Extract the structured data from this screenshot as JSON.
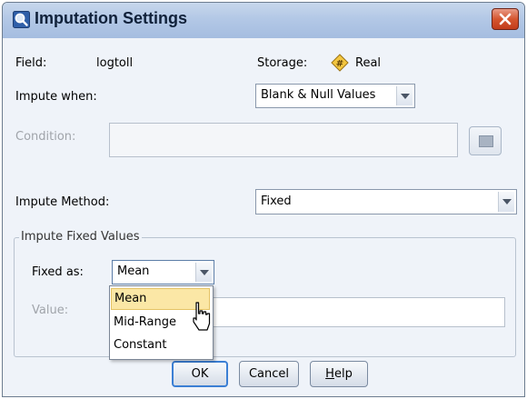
{
  "window": {
    "title": "Imputation Settings",
    "close_label": "Close"
  },
  "field": {
    "label": "Field:",
    "value": "logtoll"
  },
  "storage": {
    "label": "Storage:",
    "value": "Real",
    "icon": "real-storage-icon"
  },
  "impute_when": {
    "label": "Impute when:",
    "value": "Blank & Null Values"
  },
  "condition": {
    "label": "Condition:",
    "value": ""
  },
  "impute_method": {
    "label": "Impute Method:",
    "value": "Fixed"
  },
  "fixed_group": {
    "title": "Impute Fixed Values",
    "fixed_as_label": "Fixed as:",
    "fixed_as_value": "Mean",
    "value_label": "Value:",
    "dropdown_options": [
      "Mean",
      "Mid-Range",
      "Constant"
    ],
    "highlighted_option": "Mean"
  },
  "buttons": {
    "ok": "OK",
    "cancel": "Cancel",
    "help": "Help",
    "help_mnemonic": "H",
    "help_rest": "elp"
  },
  "colors": {
    "title_bar": "#b3c8e6",
    "close_button": "#d5552f",
    "highlight": "#fbe7a6",
    "default_button_border": "#3b7fd4"
  }
}
